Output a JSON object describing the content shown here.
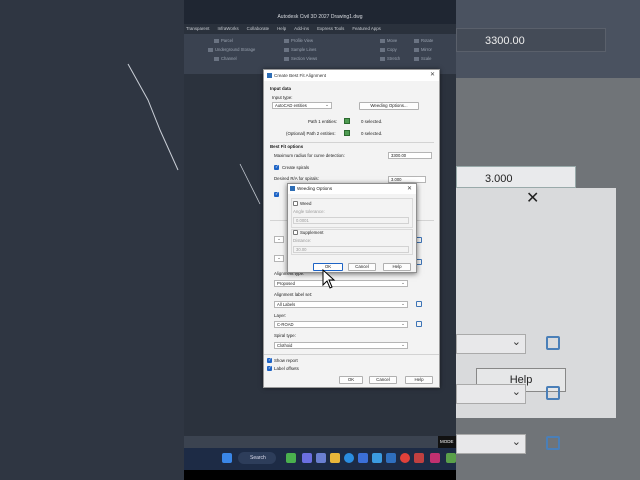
{
  "window": {
    "title": "Autodesk Civil 3D 2027   Drawing1.dwg"
  },
  "menu": [
    "Transparent",
    "InfraWorks",
    "Collaborate",
    "Help",
    "Add-ins",
    "Express Tools",
    "Featured Apps"
  ],
  "ribbon": {
    "items": [
      "Parcel",
      "Underground Storage",
      "Channel",
      "Profile View",
      "Sample Lines",
      "Section Views",
      "Move",
      "Copy",
      "Stretch",
      "Rotate",
      "Mirror",
      "Scale"
    ]
  },
  "background_right": {
    "field_top": "3300.00",
    "field_mid": "3.000",
    "help": "Help"
  },
  "main_dialog": {
    "title": "Create Best Fit Alignment",
    "input_data": "Input data",
    "input_type_label": "Input type:",
    "input_type_value": "AutoCAD entities",
    "weeding_button": "Weeding Options...",
    "path1_label": "Path 1 entities:",
    "path1_value": "0 selected.",
    "path2_label": "(Optional) Path 2 entities:",
    "path2_value": "0 selected.",
    "best_fit_options": "Best Fit options",
    "max_radius_label": "Maximum radius for curve detection:",
    "max_radius_value": "3300.00",
    "create_spirals": "Create spirals",
    "desired_ra_label": "Desired R/A for spirals:",
    "desired_ra_value": "3.000",
    "alignment_type_label": "Alignment type:",
    "alignment_type_value": "Proposed",
    "label_set_label": "Alignment label set:",
    "label_set_value": "All Labels",
    "layer_label": "Layer:",
    "layer_value": "C-ROAD",
    "spiral_type_label": "Spiral type:",
    "spiral_type_value": "Clothoid",
    "show_report": "Show report",
    "label_offsets": "Label offsets",
    "ok": "OK",
    "cancel": "Cancel",
    "help": "Help"
  },
  "weed_dialog": {
    "title": "Weeding Options",
    "weed": "Weed",
    "angle_tolerance_label": "Angle tolerance:",
    "angle_tolerance_value": "0.0001",
    "supplement": "Supplement",
    "distance_label": "Distance:",
    "distance_value": "30.00",
    "ok": "OK",
    "cancel": "Cancel",
    "help": "Help"
  },
  "statusbar": {
    "mode": "MODE"
  },
  "taskbar": {
    "search": "Search"
  },
  "colors": {
    "accent": "#1d63c5",
    "dialog_bg": "#f3f3f3",
    "app_bg": "#2b323d",
    "taskbar": "#1d2b45"
  }
}
